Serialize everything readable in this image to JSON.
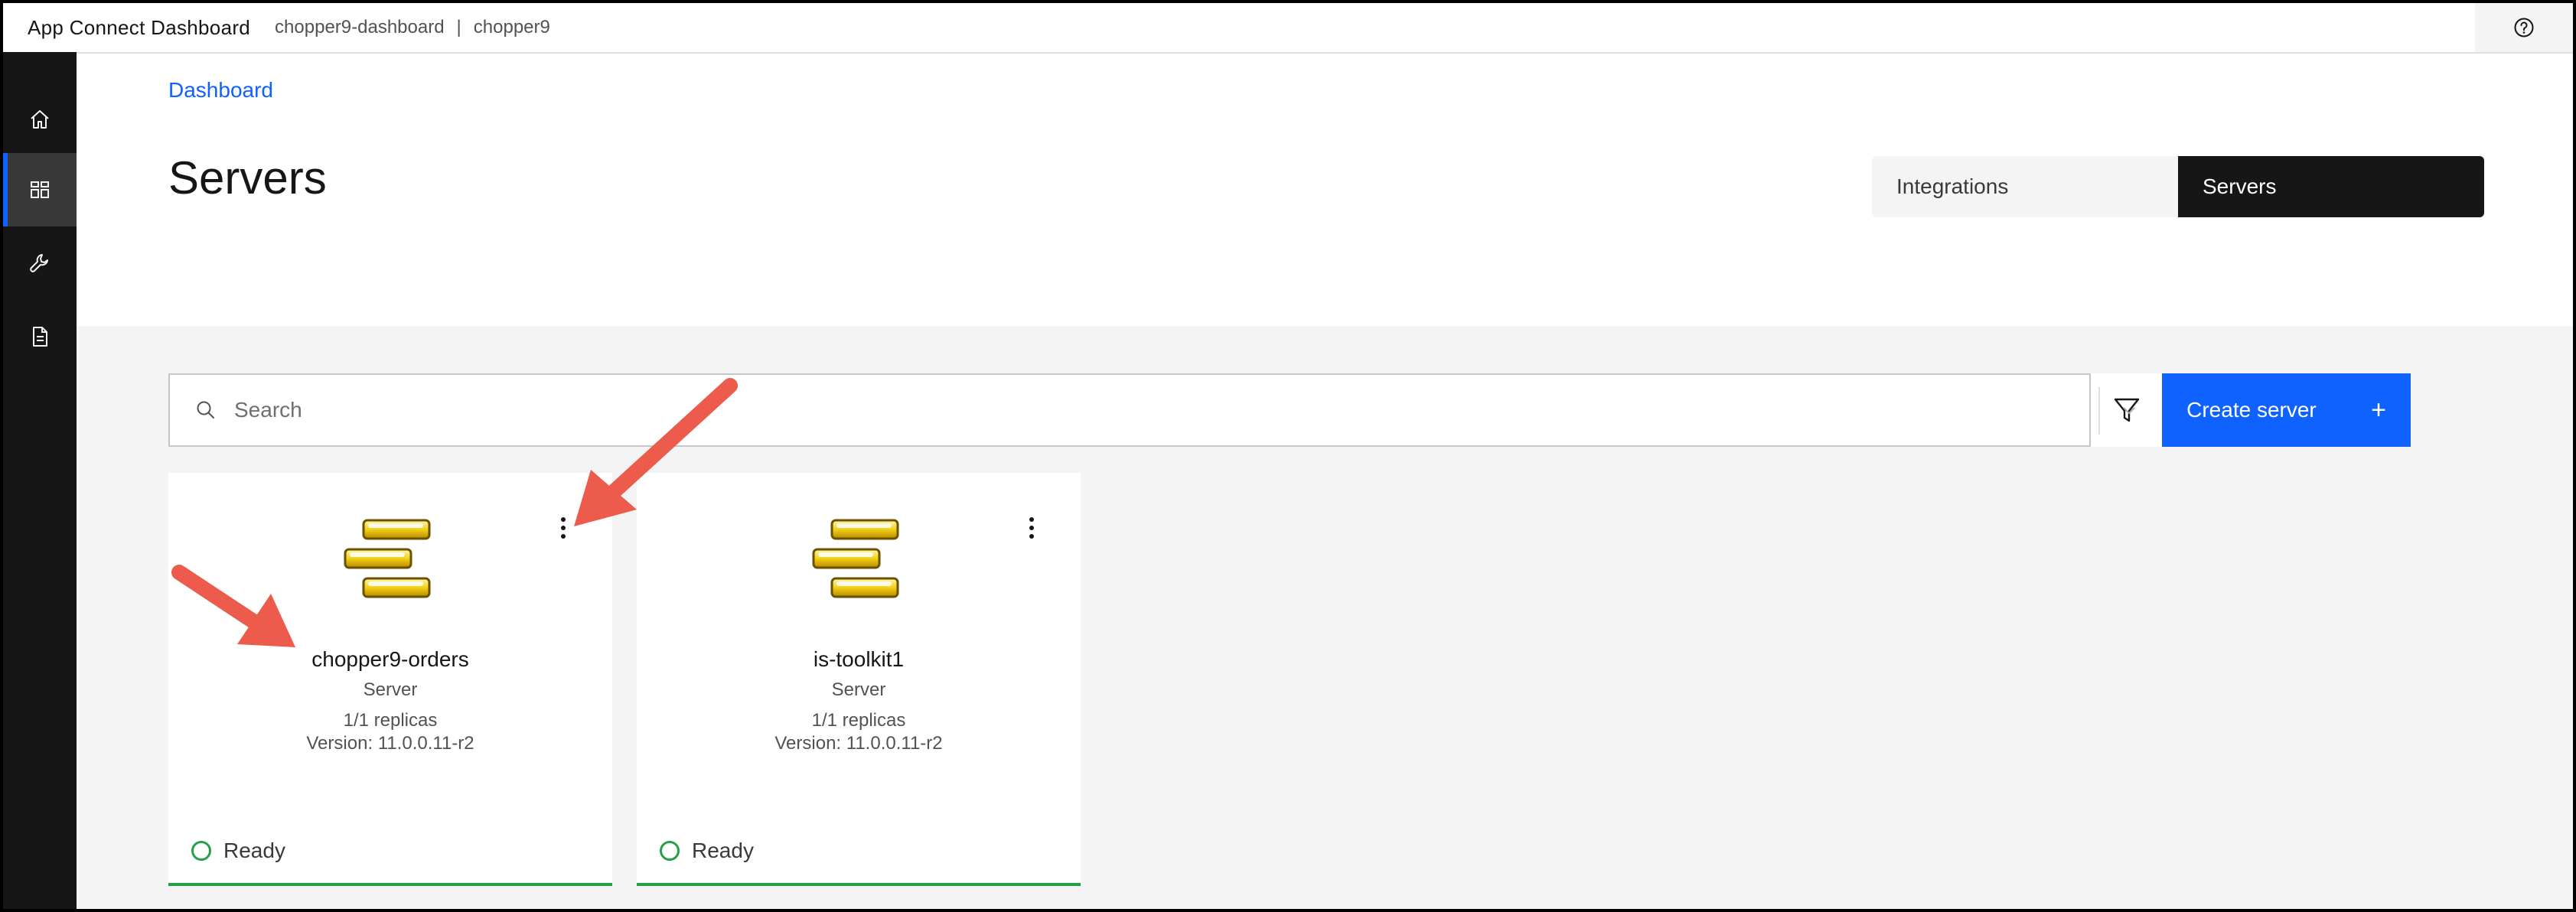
{
  "header": {
    "app_name": "App Connect Dashboard",
    "instance": "chopper9-dashboard",
    "separator": "|",
    "namespace": "chopper9"
  },
  "rail": {
    "items": [
      {
        "icon": "home-icon"
      },
      {
        "icon": "dashboard-icon",
        "active": true
      },
      {
        "icon": "wrench-icon"
      },
      {
        "icon": "document-icon"
      }
    ]
  },
  "breadcrumb": "Dashboard",
  "page_title": "Servers",
  "view_switcher": {
    "integrations_label": "Integrations",
    "servers_label": "Servers",
    "selected": "Servers"
  },
  "search": {
    "placeholder": "Search",
    "value": ""
  },
  "create_button_label": "Create server",
  "create_button_icon": "+",
  "cards": [
    {
      "name": "chopper9-orders",
      "type": "Server",
      "replicas": "1/1 replicas",
      "version": "Version: 11.0.0.11-r2",
      "status": "Ready"
    },
    {
      "name": "is-toolkit1",
      "type": "Server",
      "replicas": "1/1 replicas",
      "version": "Version: 11.0.0.11-r2",
      "status": "Ready"
    }
  ],
  "colors": {
    "accent": "#0f62fe",
    "status_ready": "#24a148",
    "annotation_arrow": "#ec5b4b",
    "server_icon_fill": "#f2d017"
  }
}
